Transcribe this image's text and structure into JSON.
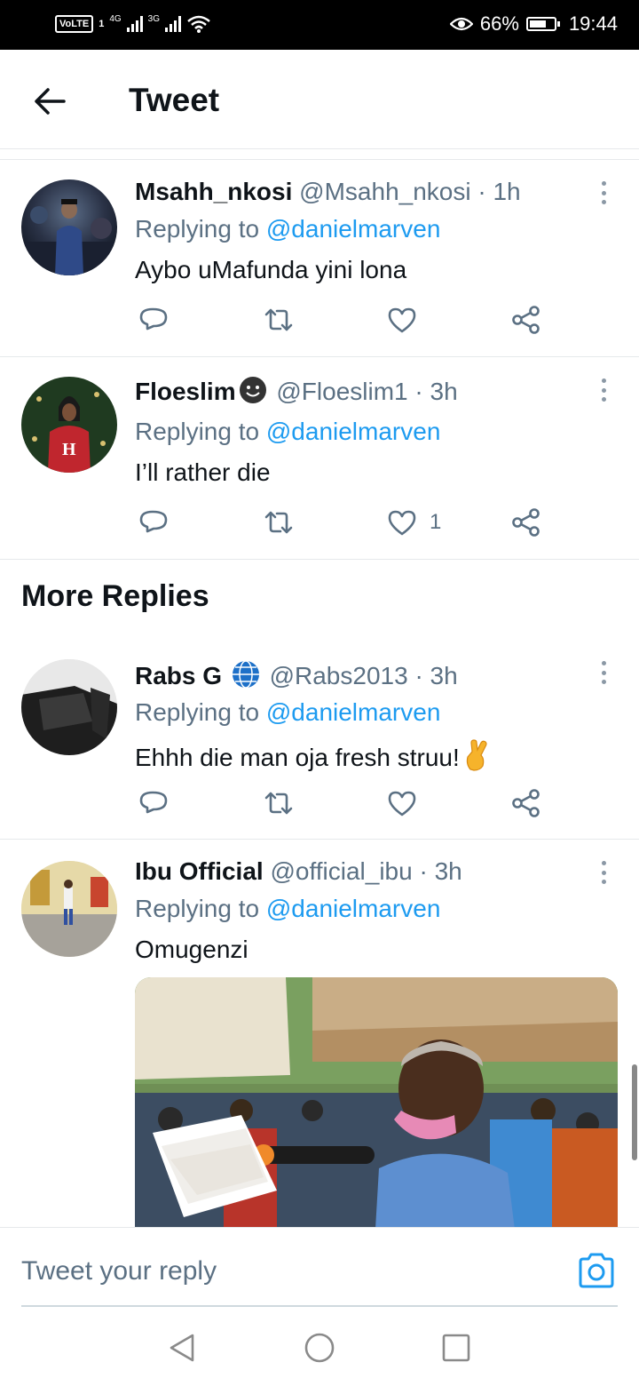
{
  "status_bar": {
    "volte": "VoLTE",
    "sim": "1",
    "network1": "4G",
    "network2": "3G",
    "battery": "66%",
    "time": "19:44"
  },
  "header": {
    "title": "Tweet"
  },
  "tweets": [
    {
      "name": "Msahh_nkosi",
      "handle": "@Msahh_nkosi",
      "time": "· 1h",
      "replying_label": "Replying to",
      "replying_to": "@danielmarven",
      "text": "Aybo uMafunda yini lona",
      "likes": ""
    },
    {
      "name": "Floeslim",
      "handle": "@Floeslim1",
      "time": "· 3h",
      "replying_label": "Replying to",
      "replying_to": "@danielmarven",
      "text": "I’ll rather die",
      "likes": "1"
    },
    {
      "name": "Rabs G",
      "handle": "@Rabs2013",
      "time": "· 3h",
      "replying_label": "Replying to",
      "replying_to": "@danielmarven",
      "text": "Ehhh die man oja fresh struu!",
      "likes": ""
    },
    {
      "name": "Ibu Official",
      "handle": "@official_ibu",
      "time": "· 3h",
      "replying_label": "Replying to",
      "replying_to": "@danielmarven",
      "text": "Omugenzi",
      "likes": ""
    }
  ],
  "section": {
    "more_replies": "More Replies"
  },
  "reply_bar": {
    "placeholder": "Tweet your reply"
  },
  "icons": [
    "back-arrow-icon",
    "more-vertical-icon",
    "reply-icon",
    "retweet-icon",
    "like-icon",
    "share-icon",
    "smiley-emoji-icon",
    "globe-emoji-icon",
    "crossed-fingers-emoji-icon",
    "camera-icon",
    "nav-back-icon",
    "nav-home-icon",
    "nav-recents-icon"
  ],
  "colors": {
    "accent": "#1d9bf0",
    "secondary_text": "#5b7083",
    "primary_text": "#0f1419"
  }
}
